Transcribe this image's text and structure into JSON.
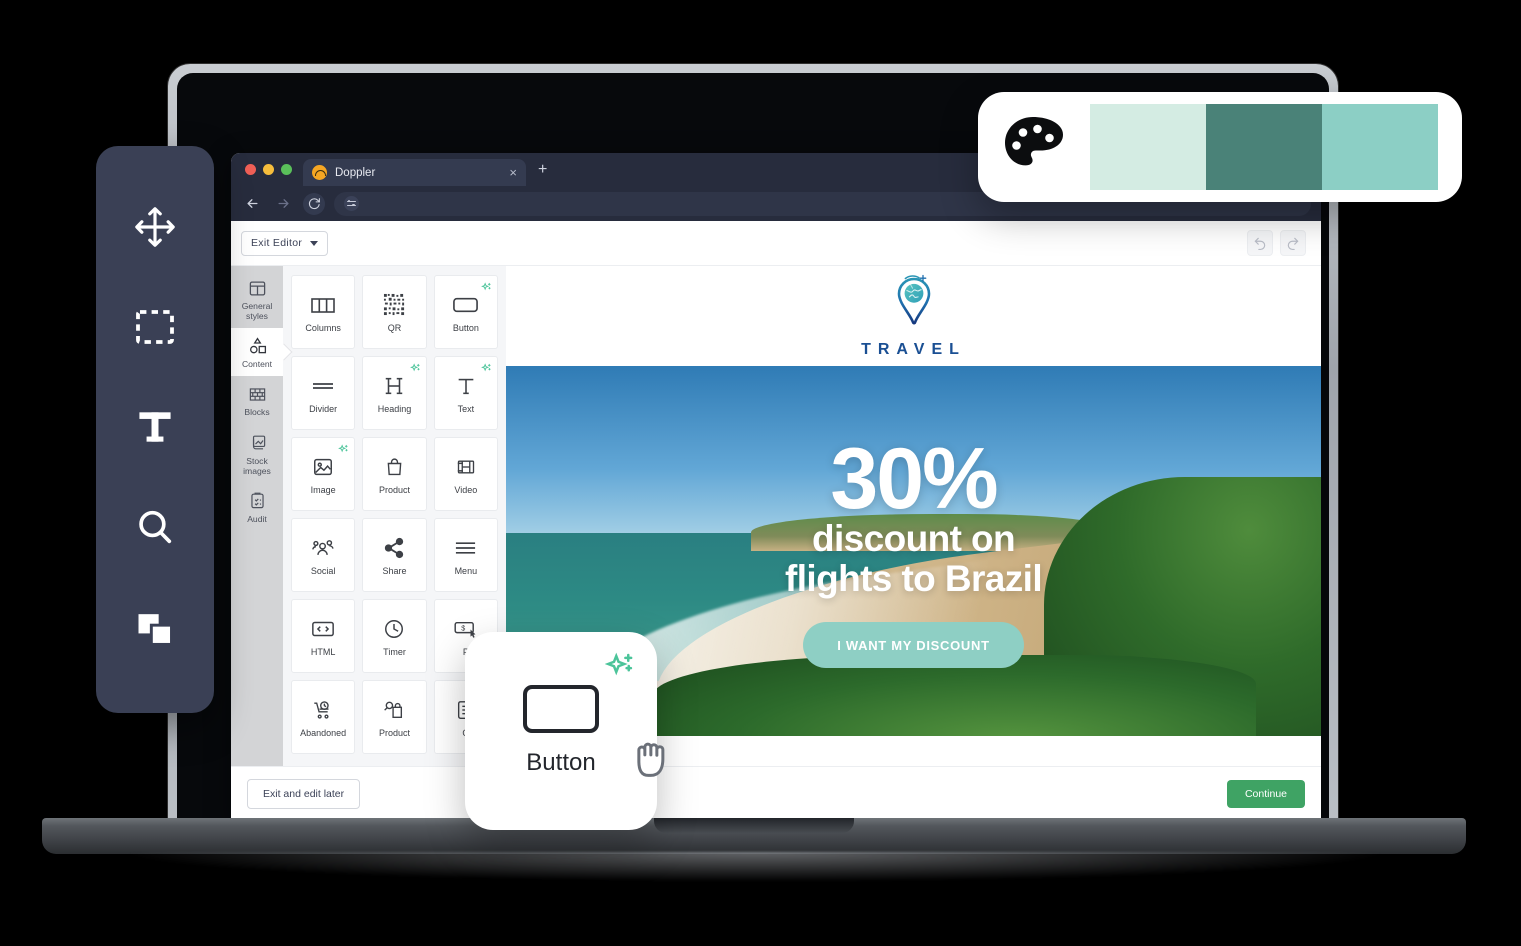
{
  "browser": {
    "tab_title": "Doppler",
    "tab_close_label": "×",
    "new_tab_label": "+",
    "back_icon": "arrow-left-icon",
    "forward_icon": "arrow-right-icon",
    "reload_icon": "reload-icon",
    "url_value": "",
    "url_placeholder": ""
  },
  "editor": {
    "exit_editor_label": "Exit Editor",
    "undo_label": "↩",
    "redo_label": "↪",
    "rail": [
      {
        "label": "General styles",
        "icon": "layout-icon",
        "active": false
      },
      {
        "label": "Content",
        "icon": "shapes-icon",
        "active": true
      },
      {
        "label": "Blocks",
        "icon": "bricks-icon",
        "active": false
      },
      {
        "label": "Stock images",
        "icon": "image-stack-icon",
        "active": false
      },
      {
        "label": "Audit",
        "icon": "clipboard-check-icon",
        "active": false
      }
    ],
    "tiles": [
      {
        "label": "Columns",
        "icon": "columns-icon",
        "sparkle": false
      },
      {
        "label": "QR",
        "icon": "qr-code-icon",
        "sparkle": false
      },
      {
        "label": "Button",
        "icon": "button-icon",
        "sparkle": true
      },
      {
        "label": "Divider",
        "icon": "divider-icon",
        "sparkle": false
      },
      {
        "label": "Heading",
        "icon": "heading-h-icon",
        "sparkle": true
      },
      {
        "label": "Text",
        "icon": "text-t-icon",
        "sparkle": true
      },
      {
        "label": "Image",
        "icon": "image-icon",
        "sparkle": true
      },
      {
        "label": "Product",
        "icon": "shopping-bag-icon",
        "sparkle": false
      },
      {
        "label": "Video",
        "icon": "film-icon",
        "sparkle": false
      },
      {
        "label": "Social",
        "icon": "social-group-icon",
        "sparkle": false
      },
      {
        "label": "Share",
        "icon": "share-icon",
        "sparkle": false
      },
      {
        "label": "Menu",
        "icon": "hamburger-menu-icon",
        "sparkle": false
      },
      {
        "label": "HTML",
        "icon": "code-brackets-icon",
        "sparkle": false
      },
      {
        "label": "Timer",
        "icon": "clock-icon",
        "sparkle": false
      },
      {
        "label": "P",
        "icon": "payment-button-icon",
        "sparkle": false
      },
      {
        "label": "Abandoned",
        "icon": "abandoned-cart-icon",
        "sparkle": false
      },
      {
        "label": "Product",
        "icon": "product-tag-icon",
        "sparkle": false
      },
      {
        "label": "O",
        "icon": "order-icon",
        "sparkle": false
      }
    ],
    "footer": {
      "exit_and_edit_later_label": "Exit and edit later",
      "continue_label": "Continue",
      "continue_color": "#3fa364"
    }
  },
  "email": {
    "logo_text": "TRAVEL",
    "logo_icon": "travel-pin-globe-icon",
    "hero": {
      "percent": "30%",
      "line1": "discount on",
      "line2": "flights to Brazil",
      "cta_label": "I WANT MY DISCOUNT",
      "cta_color": "#8ecfc4"
    }
  },
  "tool_dock": {
    "items": [
      {
        "icon": "move-arrows-icon"
      },
      {
        "icon": "dashed-selection-icon"
      },
      {
        "icon": "text-tool-icon"
      },
      {
        "icon": "magnifier-icon"
      },
      {
        "icon": "duplicate-squares-icon"
      }
    ],
    "background_color": "#3a4055"
  },
  "palette_card": {
    "icon": "color-palette-icon",
    "swatches": [
      "#d4ece3",
      "#4a8278",
      "#8ccfc5"
    ]
  },
  "button_card": {
    "label": "Button",
    "icon": "button-icon",
    "sparkle_icon": "ai-sparkle-icon",
    "sparkle_color": "#4cc49a",
    "cursor_icon": "grabbing-hand-cursor-icon"
  }
}
